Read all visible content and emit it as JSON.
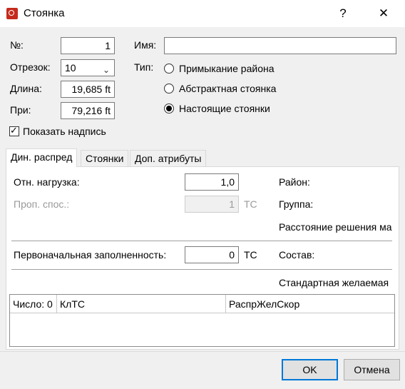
{
  "window": {
    "title": "Стоянка",
    "help_glyph": "?",
    "close_glyph": "✕",
    "app_icon": "parking-lot-icon"
  },
  "general": {
    "number_label": "№:",
    "number_value": "1",
    "segment_label": "Отрезок:",
    "segment_value": "10",
    "length_label": "Длина:",
    "length_value": "19,685 ft",
    "at_label": "При:",
    "at_value": "79,216 ft",
    "name_label": "Имя:",
    "name_value": "",
    "type_label": "Тип:",
    "type_options": [
      {
        "label": "Примыкание района",
        "checked": false
      },
      {
        "label": "Абстрактная стоянка",
        "checked": false
      },
      {
        "label": "Настоящие стоянки",
        "checked": true
      }
    ],
    "show_label_checkbox": "Показать надпись",
    "show_label_checked": true,
    "check_glyph": "✓"
  },
  "tabs": [
    {
      "label": "Дин. распред",
      "active": true
    },
    {
      "label": "Стоянки",
      "active": false
    },
    {
      "label": "Доп. атрибуты",
      "active": false
    }
  ],
  "dyn": {
    "rel_load_label": "Отн. нагрузка:",
    "rel_load_value": "1,0",
    "capacity_label": "Проп. спос.:",
    "capacity_value": "1",
    "capacity_unit": "ТС",
    "initial_occ_label": "Первоначальная заполненность:",
    "initial_occ_value": "0",
    "initial_occ_unit": "ТС",
    "district_label": "Район:",
    "group_label": "Группа:",
    "decision_dist_label": "Расстояние решения ма",
    "composition_label": "Состав:",
    "standard_desired_label": "Стандартная желаемая"
  },
  "table": {
    "columns": [
      "Число: 0",
      "КлТС",
      "РаспрЖелСкор"
    ]
  },
  "buttons": {
    "ok": "OK",
    "cancel": "Отмена"
  }
}
